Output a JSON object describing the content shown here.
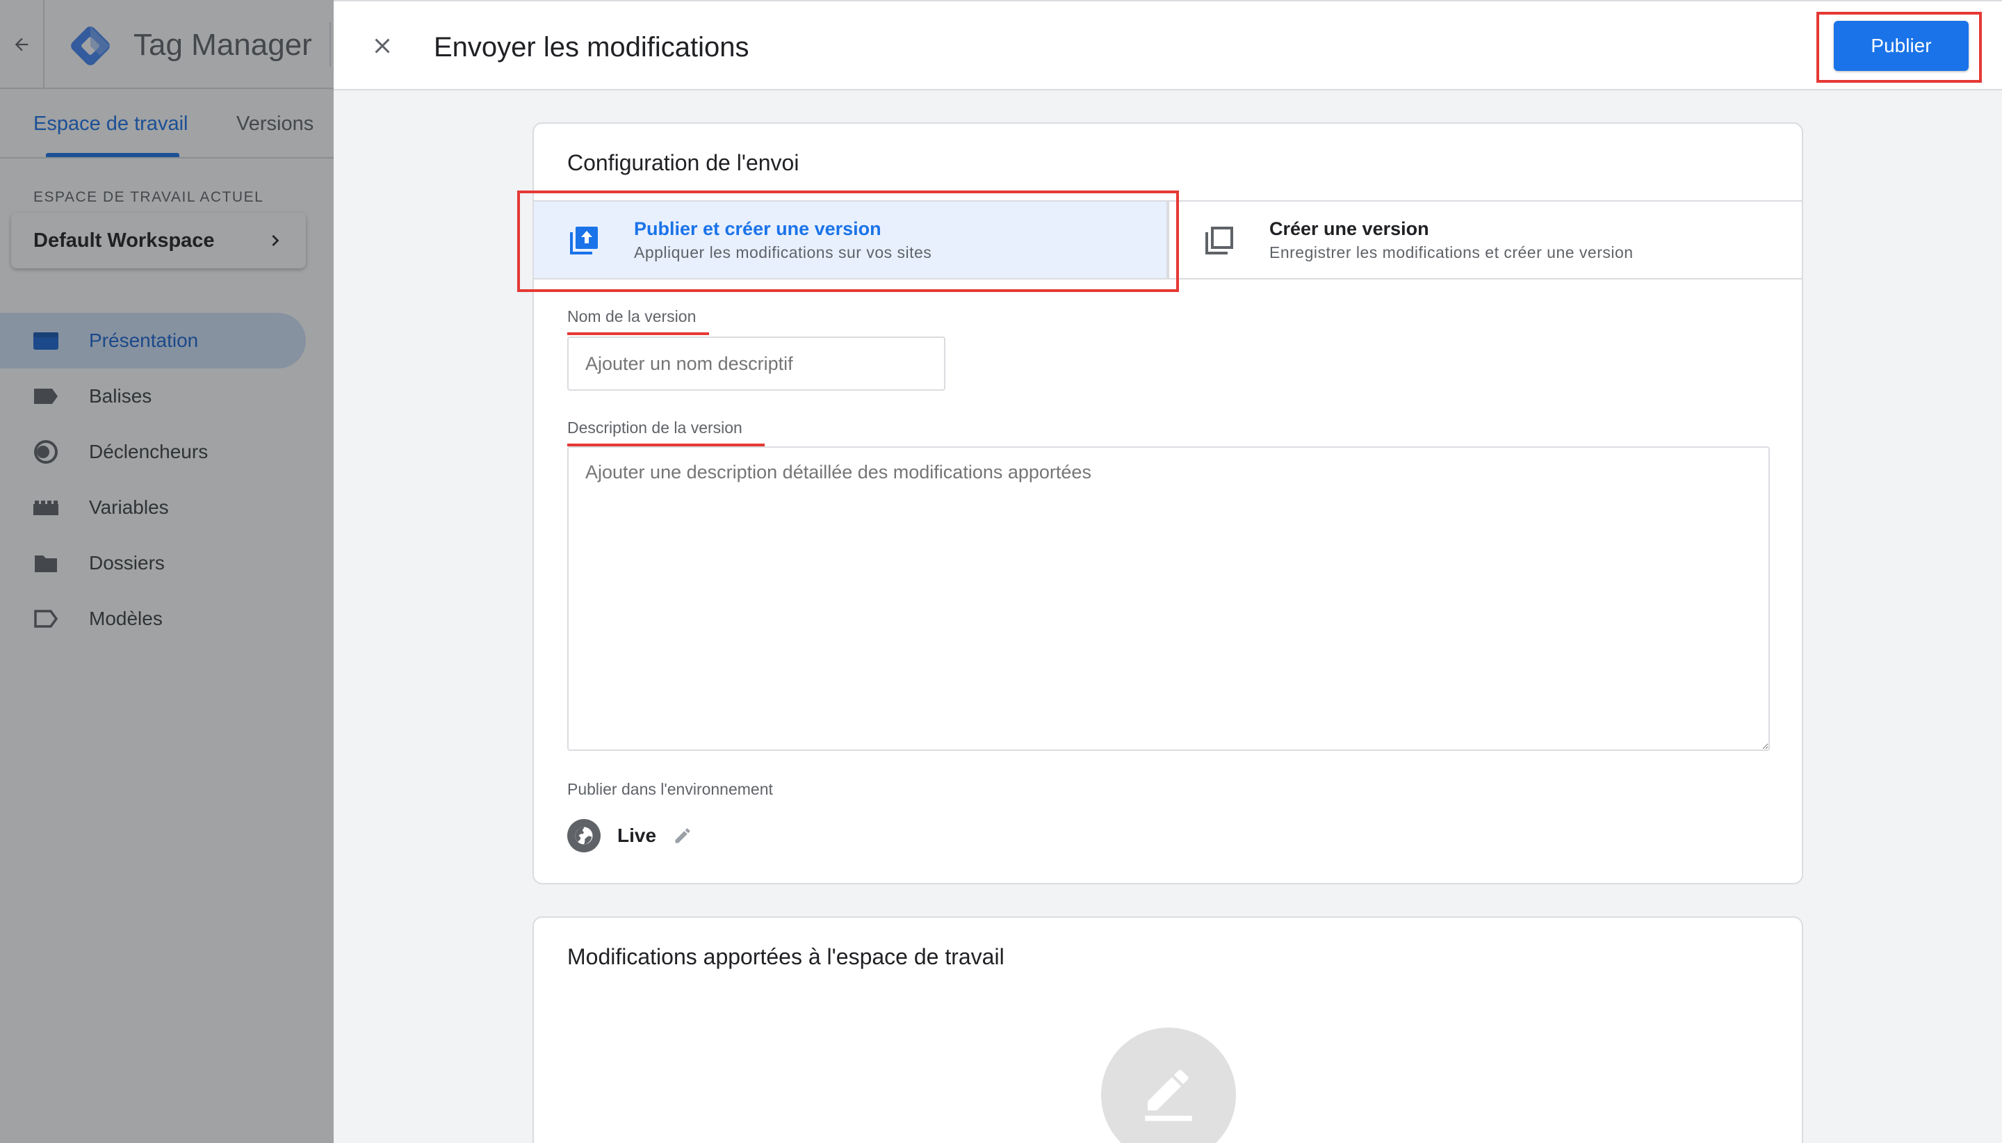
{
  "app": {
    "product_name": "Tag Manager",
    "tabs": [
      {
        "label": "Espace de travail",
        "active": true
      },
      {
        "label": "Versions",
        "active": false
      }
    ],
    "workspace_label": "ESPACE DE TRAVAIL ACTUEL",
    "workspace_name": "Default Workspace",
    "nav": [
      {
        "label": "Présentation",
        "icon": "overview-icon",
        "active": true
      },
      {
        "label": "Balises",
        "icon": "tag-icon",
        "active": false
      },
      {
        "label": "Déclencheurs",
        "icon": "trigger-icon",
        "active": false
      },
      {
        "label": "Variables",
        "icon": "variables-icon",
        "active": false
      },
      {
        "label": "Dossiers",
        "icon": "folder-icon",
        "active": false
      },
      {
        "label": "Modèles",
        "icon": "template-icon",
        "active": false
      }
    ]
  },
  "panel": {
    "title": "Envoyer les modifications",
    "publish_button": "Publier",
    "config": {
      "title": "Configuration de l'envoi",
      "options": [
        {
          "title": "Publier et créer une version",
          "subtitle": "Appliquer les modifications sur vos sites",
          "selected": true
        },
        {
          "title": "Créer une version",
          "subtitle": "Enregistrer les modifications et créer une version",
          "selected": false
        }
      ],
      "version_name_label": "Nom de la version",
      "version_name_placeholder": "Ajouter un nom descriptif",
      "version_name_value": "",
      "description_label": "Description de la version",
      "description_placeholder": "Ajouter une description détaillée des modifications apportées",
      "description_value": "",
      "environment_label": "Publier dans l'environnement",
      "environment_name": "Live"
    },
    "changes": {
      "title": "Modifications apportées à l'espace de travail"
    }
  },
  "colors": {
    "accent": "#1a73e8",
    "highlight": "#e53935",
    "selected_bg": "#e8f0fe"
  }
}
